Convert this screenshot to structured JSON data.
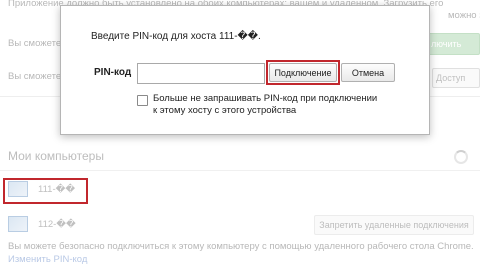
{
  "background": {
    "top_text": "Приложение должно быть установлено на обоих компьютерах: вашем и удаленном. Загрузить его",
    "top_text2": "можно за",
    "line1": "Вы сможете",
    "line2": "Вы сможете",
    "enable_button": "лючить",
    "access_button": "Доступ",
    "section_title": "Мои компьютеры",
    "hosts": [
      {
        "name": "111-��"
      },
      {
        "name": "112-��"
      }
    ],
    "revoke_button": "Запретить удаленные подключения",
    "footer_text": "Вы можете безопасно подключиться к этому компьютеру с помощью удаленного рабочего стола Chrome.",
    "footer_link": "Изменить PIN-код"
  },
  "dialog": {
    "title": "Введите PIN-код для хоста 111-��.",
    "pin_label": "PIN-код",
    "pin_value": "",
    "connect_button": "Подключение",
    "cancel_button": "Отмена",
    "checkbox_label": "Больше не запрашивать PIN-код при подключении к этому хосту с этого устройства",
    "checkbox_checked": false
  },
  "colors": {
    "highlight": "#c1272d"
  }
}
